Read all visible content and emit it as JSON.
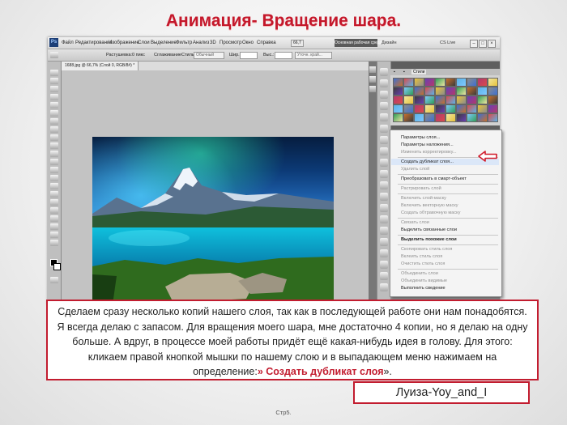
{
  "slide": {
    "title": "Анимация- Вращение шара.",
    "caption_main": "Сделаем сразу несколько копий нашего слоя, так как в последующей работе они нам понадобятся. Я всегда делаю с запасом. Для вращения моего шара, мне достаточно 4 копии, но я делаю на одну больше. А вдруг, в процессе моей работы придёт ещё какая-нибудь идея в голову.  Для этого: кликаем правой кнопкой мышки по нашему слою и в выпадающем меню нажимаем на определение:",
    "caption_highlight": "» Создать дубликат слоя",
    "caption_end": "».",
    "author": "Луиза-Yoy_and_I",
    "page_number": "Стр5.",
    "accent_color": "#c21c2f"
  },
  "photoshop": {
    "logo": "Ps",
    "zoom": "66,7",
    "menu": [
      "Файл",
      "Редактирование",
      "Изображение",
      "Слои",
      "Выделение",
      "Фильтр",
      "Анализ",
      "3D",
      "Просмотр",
      "Окно",
      "Справка"
    ],
    "workspace_button": "Основная рабочая среда",
    "design_label": "Дизайн",
    "cslive_label": "CS Live",
    "options": {
      "feather_label": "Растушевка:",
      "feather_value": "0 пикс",
      "antialias_label": "Сглаживание",
      "style_label": "Стиль:",
      "style_value": "Обычный",
      "width_label": "Шир.:",
      "height_label": "Выс.:",
      "refine_button": "Уточн. край..."
    },
    "document_tab": "1688.jpg @ 66,7% (Слой 0, RGB/8#) *",
    "styles_tab": "Стили"
  },
  "context_menu": {
    "items": [
      {
        "label": "Параметры слоя...",
        "state": "enabled"
      },
      {
        "label": "Параметры наложения...",
        "state": "enabled"
      },
      {
        "label": "Изменить корректировку...",
        "state": "disabled"
      },
      {
        "label": "Создать дубликат слоя...",
        "state": "highlighted"
      },
      {
        "label": "Удалить слой",
        "state": "disabled"
      },
      {
        "label": "Преобразовать в смарт-объект",
        "state": "enabled"
      },
      {
        "label": "Растрировать слой",
        "state": "disabled"
      },
      {
        "label": "Включить слой-маску",
        "state": "disabled"
      },
      {
        "label": "Включить векторную маску",
        "state": "disabled"
      },
      {
        "label": "Создать обтравочную маску",
        "state": "disabled"
      },
      {
        "label": "Связать слои",
        "state": "disabled"
      },
      {
        "label": "Выделить связанные слои",
        "state": "enabled"
      },
      {
        "label": "Выделить похожие слои",
        "state": "bold"
      },
      {
        "label": "Скопировать стиль слоя",
        "state": "disabled"
      },
      {
        "label": "Вклеить стиль слоя",
        "state": "disabled"
      },
      {
        "label": "Очистить стиль слоя",
        "state": "disabled"
      },
      {
        "label": "Объединить слои",
        "state": "disabled"
      },
      {
        "label": "Объединить видимые",
        "state": "disabled"
      },
      {
        "label": "Выполнить сведение",
        "state": "enabled"
      }
    ]
  }
}
